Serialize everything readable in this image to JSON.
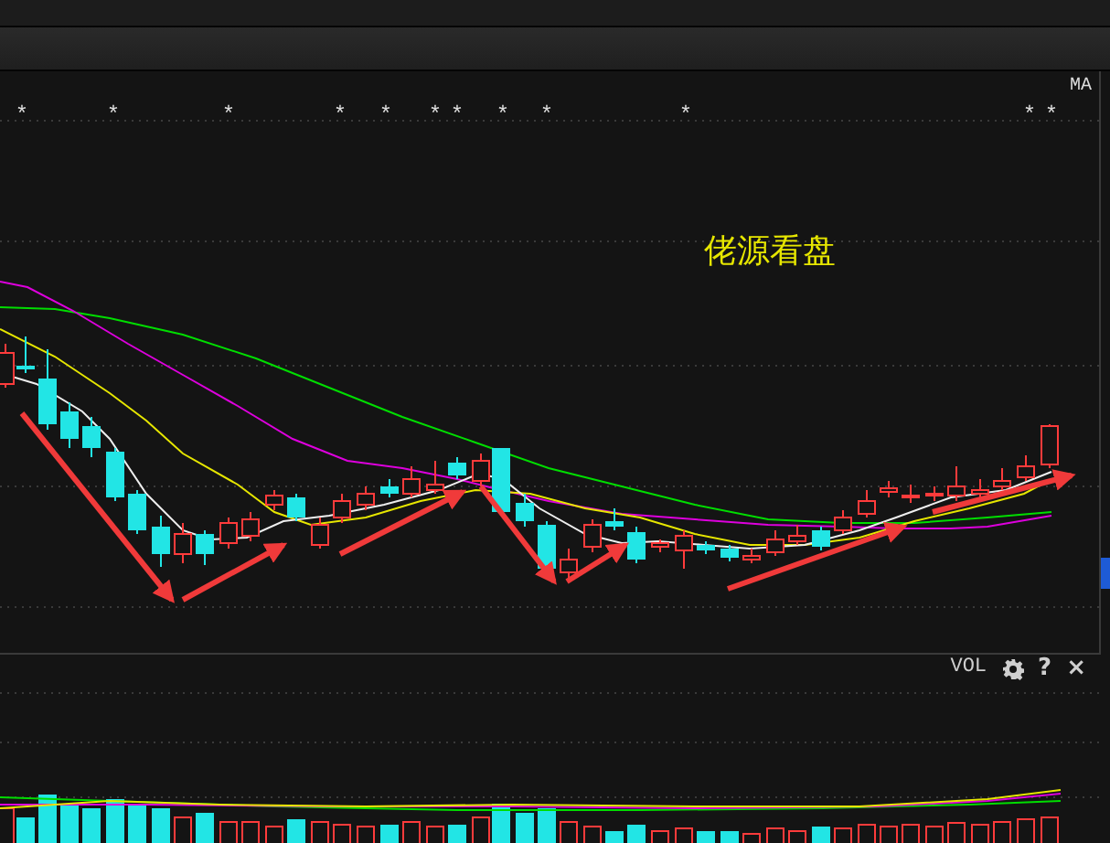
{
  "main_chart": {
    "indicator": "MA",
    "signal_marks": [
      "*",
      "*",
      "*",
      "*",
      "*",
      "*",
      "*",
      "*",
      "*",
      "*",
      "*",
      "*"
    ],
    "annotation": "佬源看盘"
  },
  "volume_panel": {
    "indicator": "VOL",
    "buttons": [
      {
        "kind": "settings"
      },
      {
        "kind": "help",
        "label": "?"
      },
      {
        "kind": "close",
        "label": "×"
      }
    ]
  }
}
